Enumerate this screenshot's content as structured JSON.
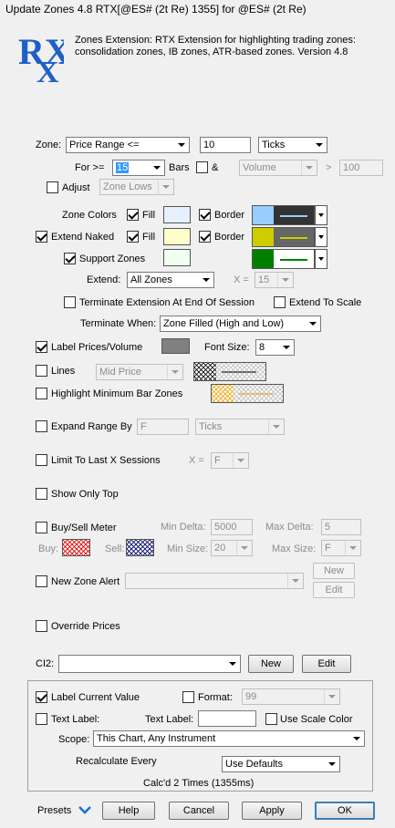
{
  "window": {
    "title": "Update Zones 4.8 RTX[@ES# (2t Re) 1355] for @ES# (2t Re)"
  },
  "header": {
    "logo_text": "RX",
    "description_line1": "Zones Extension: RTX Extension for highlighting trading zones:",
    "description_line2": "consolidation zones, IB zones, ATR-based zones. Version 4.8"
  },
  "zone": {
    "label": "Zone:",
    "type": "Price Range <=",
    "value": "10",
    "unit": "Ticks",
    "for_label": "For >=",
    "bars_value": "15",
    "bars_label": "Bars",
    "and_label": "&",
    "and_type": "Volume",
    "gt_label": ">",
    "volume_value": "100",
    "adjust_label": "Adjust",
    "adjust_value": "Zone Lows"
  },
  "colors": {
    "zone_colors_label": "Zone Colors",
    "fill_label": "Fill",
    "border_label": "Border",
    "extend_naked_label": "Extend Naked",
    "support_zones_label": "Support Zones",
    "zone_fill": "#e6f0ff",
    "zone_border_bg": "#333333",
    "zone_border_left": "#99ccff",
    "naked_fill": "#ffffcc",
    "naked_border_bg": "#666666",
    "naked_border_left": "#cccc00",
    "support_fill": "#f0fff0",
    "support_border_left": "#008000"
  },
  "extend": {
    "label": "Extend:",
    "value": "All Zones",
    "x_label": "X =",
    "x_value": "15",
    "terminate_label": "Terminate Extension At End Of Session",
    "scale_label": "Extend To Scale",
    "term_when_label": "Terminate When:",
    "term_when_value": "Zone Filled (High and Low)"
  },
  "label_prices": {
    "label": "Label Prices/Volume",
    "font_label": "Font Size:",
    "font_value": "8",
    "box_color": "#808080"
  },
  "lines": {
    "label": "Lines",
    "value": "Mid Price"
  },
  "highlight": {
    "label": "Highlight Minimum Bar Zones"
  },
  "expand": {
    "label": "Expand Range By",
    "value": "F",
    "unit": "Ticks"
  },
  "limit": {
    "label": "Limit To Last X Sessions",
    "x_label": "X =",
    "x_value": "F"
  },
  "show_top": {
    "label": "Show Only Top"
  },
  "meter": {
    "label": "Buy/Sell Meter",
    "min_delta_label": "Min Delta:",
    "min_delta": "5000",
    "max_delta_label": "Max Delta:",
    "max_delta": "5",
    "buy_label": "Buy:",
    "sell_label": "Sell:",
    "min_size_label": "Min Size:",
    "min_size": "20",
    "max_size_label": "Max Size:",
    "max_size": "F"
  },
  "alert": {
    "label": "New Zone Alert",
    "new_label": "New",
    "edit_label": "Edit"
  },
  "override": {
    "label": "Override Prices"
  },
  "ci": {
    "label": "CI2:",
    "new_label": "New",
    "edit_label": "Edit"
  },
  "group": {
    "label_current": "Label Current Value",
    "format_label": "Format:",
    "format_value": "99",
    "text_label_cb": "Text Label:",
    "text_label_lbl": "Text Label:",
    "scale_color": "Use Scale Color",
    "scope_label": "Scope:",
    "scope_value": "This Chart, Any Instrument",
    "recalc_label": "Recalculate Every",
    "recalc_value": "Use Defaults",
    "status": "Calc'd 2 Times (1355ms)"
  },
  "footer": {
    "presets": "Presets",
    "help": "Help",
    "cancel": "Cancel",
    "apply": "Apply",
    "ok": "OK"
  }
}
